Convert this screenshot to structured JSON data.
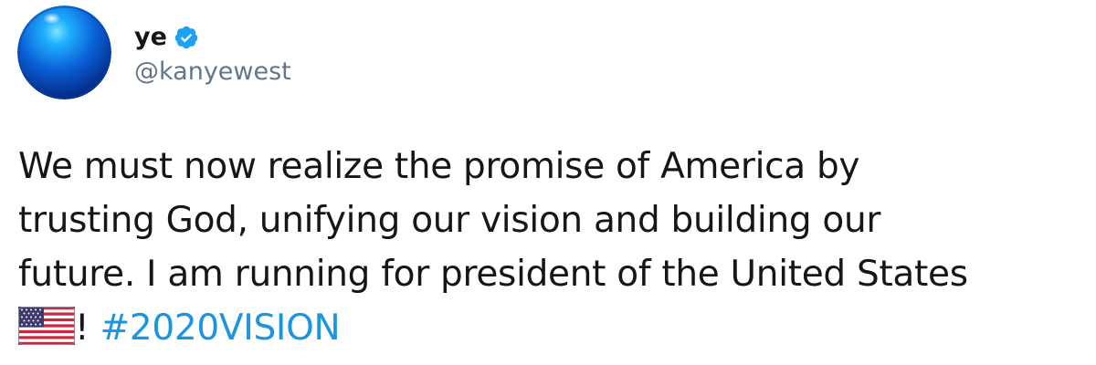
{
  "user": {
    "display_name": "ye",
    "handle": "@kanyewest",
    "verified": true,
    "avatar_icon": "blue-globe-avatar"
  },
  "tweet": {
    "lines": [
      "We must now realize the promise of America by",
      "trusting God, unifying our vision and building our",
      "future. I am running for president of the United States"
    ],
    "flag_icon": "us-flag-icon",
    "final_text": "! ",
    "hashtag": "#2020VISION"
  },
  "colors": {
    "text": "#14171a",
    "secondary": "#657786",
    "link": "#1b95e0",
    "verified_badge": "#1da1f2"
  }
}
